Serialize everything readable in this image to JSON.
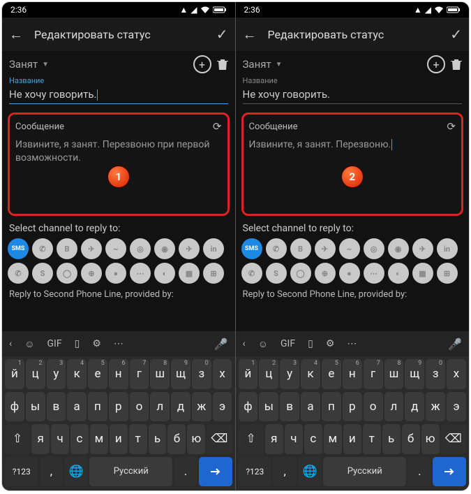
{
  "status_time": "2:36",
  "header": {
    "title": "Редактировать статус"
  },
  "status_select": "Занят",
  "name_label": "Название",
  "name_value": "Не хочу говорить.",
  "message_label": "Сообщение",
  "message_text_1": "Извините, я занят. Перезвоню при первой возможности.",
  "message_text_2": "Извините, я занят. Перезвоню.",
  "badge_1": "1",
  "badge_2": "2",
  "select_channel_label": "Select channel to reply to:",
  "sms_label": "SMS",
  "reply_line": "Reply to Second Phone Line, provided by:",
  "keyboard": {
    "gif": "GIF",
    "row1_sup": [
      "1",
      "2",
      "3",
      "4",
      "5",
      "6",
      "7",
      "8",
      "9",
      "0",
      ""
    ],
    "row1": [
      "й",
      "ц",
      "у",
      "к",
      "е",
      "н",
      "г",
      "ш",
      "щ",
      "з",
      "х"
    ],
    "row2": [
      "ф",
      "ы",
      "в",
      "а",
      "п",
      "р",
      "о",
      "л",
      "д",
      "ж",
      "э"
    ],
    "row3": [
      "я",
      "ч",
      "с",
      "м",
      "и",
      "т",
      "ь",
      "б",
      "ю"
    ],
    "numkey": "?123",
    "lang": "Русский"
  }
}
